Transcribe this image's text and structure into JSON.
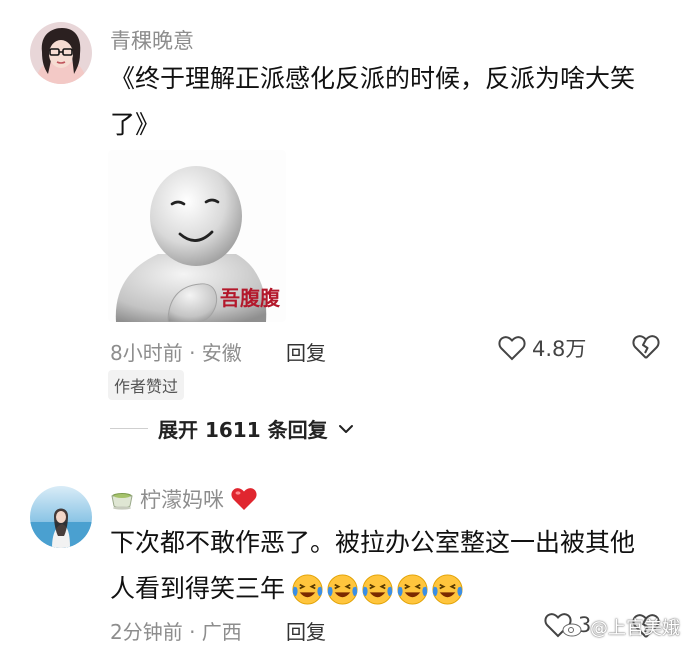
{
  "comments": [
    {
      "username": "青稞晚意",
      "text_line1": "《终于理解正派感化反派的时候，反派为啥大笑",
      "text_line2": "了》",
      "sticker_label": "吾腹腹",
      "time_location": "8小时前 · 安徽",
      "reply_label": "回复",
      "likes": "4.8万",
      "badge": "作者赞过",
      "expand_label": "展开 1611 条回复"
    },
    {
      "username_prefix_icon": "tea-cup-icon",
      "username": "柠濛妈咪",
      "username_suffix_icon": "red-heart-icon",
      "text_line1": "下次都不敢作恶了。被拉办公室整这一出被其他",
      "text_line2": "人看到得笑三年",
      "emoji_icon": "laughing-crying-face-icon",
      "emoji_count": 5,
      "time_location": "2分钟前 · 广西",
      "reply_label": "回复",
      "likes": "3"
    }
  ],
  "watermark": {
    "text": "@上官美娥",
    "icon": "weibo-logo-icon"
  },
  "colors": {
    "meta_text": "#8d8d8d",
    "sticker_label": "#b3182b",
    "heart": "#e0262f",
    "emoji_yellow": "#ffc53d",
    "emoji_tears": "#3b8fe6"
  }
}
